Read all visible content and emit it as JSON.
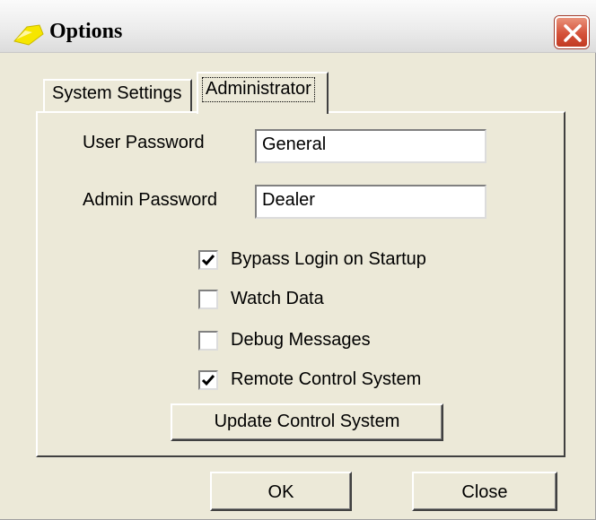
{
  "window": {
    "title": "Options"
  },
  "tabs": [
    {
      "label": "System Settings",
      "active": false
    },
    {
      "label": "Administrator",
      "active": true
    }
  ],
  "admin": {
    "user_password_label": "User Password",
    "user_password_value": "General",
    "admin_password_label": "Admin Password",
    "admin_password_value": "Dealer",
    "checkboxes": [
      {
        "label": "Bypass Login on Startup",
        "checked": true
      },
      {
        "label": "Watch Data",
        "checked": false
      },
      {
        "label": "Debug Messages",
        "checked": false
      },
      {
        "label": "Remote Control System",
        "checked": true
      }
    ],
    "update_button": "Update Control System"
  },
  "footer": {
    "ok_label": "OK",
    "close_label": "Close"
  },
  "icons": {
    "app": "folder-arrow-icon",
    "close": "close-x-icon"
  },
  "colors": {
    "close_button": "#d5523a",
    "face": "#ece9d8"
  }
}
